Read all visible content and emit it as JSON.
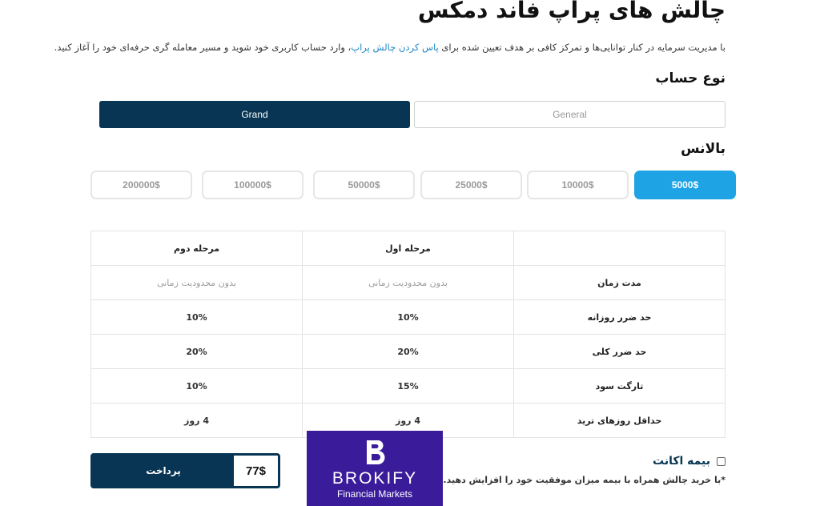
{
  "page": {
    "title": "چالش های پراپ فاند دمکس",
    "intro_before": "با مدیریت سرمایه در کنار توانایی‌ها و تمرکز کافی بر هدف تعیین شده برای ",
    "intro_link": "پاس کردن چالش پراپ",
    "intro_after": "، وارد حساب کاربری خود شوید و مسیر معامله گری حرفه‌ای خود را آغاز کنید."
  },
  "account_type": {
    "heading": "نوع حساب",
    "options": [
      {
        "label": "General",
        "active": false
      },
      {
        "label": "Grand",
        "active": true
      }
    ]
  },
  "balance": {
    "heading": "بالانس",
    "options": [
      {
        "label": "5000$",
        "active": true
      },
      {
        "label": "10000$",
        "active": false
      },
      {
        "label": "25000$",
        "active": false
      },
      {
        "label": "50000$",
        "active": false
      },
      {
        "label": "100000$",
        "active": false
      },
      {
        "label": "200000$",
        "active": false
      }
    ]
  },
  "plan_table": {
    "headers": [
      "",
      "مرحله اول",
      "مرحله دوم"
    ],
    "rows": [
      {
        "label": "مدت زمان",
        "phase1": "بدون محدودیت زمانی",
        "phase2": "بدون محدودیت زمانی"
      },
      {
        "label": "حد ضرر روزانه",
        "phase1": "10%",
        "phase2": "10%"
      },
      {
        "label": "حد ضرر کلی",
        "phase1": "20%",
        "phase2": "20%"
      },
      {
        "label": "تارگت سود",
        "phase1": "15%",
        "phase2": "10%"
      },
      {
        "label": "حداقل روزهای ترید",
        "phase1": "4 روز",
        "phase2": "4 روز"
      }
    ]
  },
  "checkout": {
    "price": "77$",
    "pay_label": "پرداخت"
  },
  "insurance": {
    "label": "بیمه اکانت",
    "checked": false,
    "note": "*با خرید چالش همراه با بیمه میزان موفقیت خود را افزایش دهید."
  },
  "logo": {
    "name": "BROKIFY",
    "sub": "Financial Markets"
  },
  "colors": {
    "primary_dark": "#073553",
    "accent_blue": "#1ea4e4",
    "logo_bg": "#3a1c9b"
  }
}
